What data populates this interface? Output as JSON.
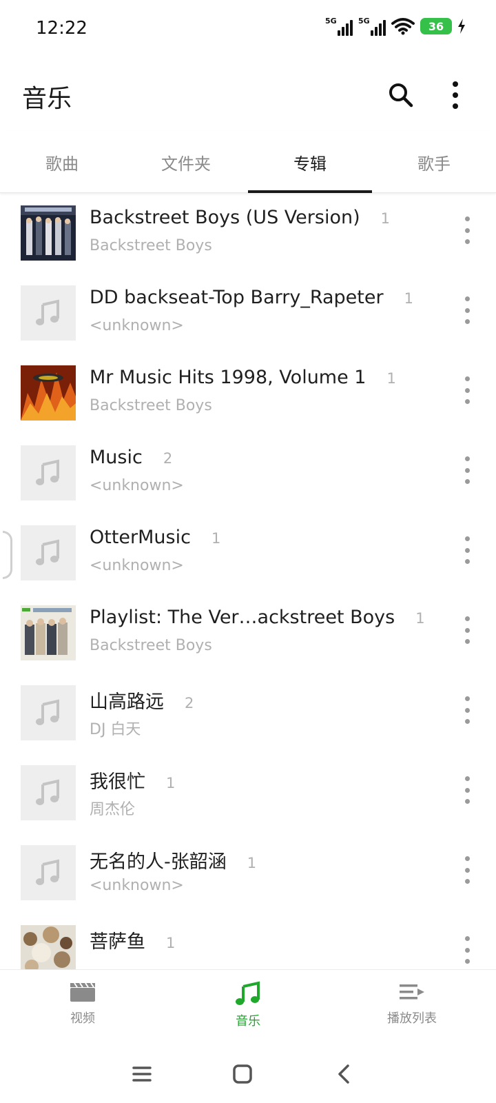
{
  "status_bar": {
    "time": "12:22",
    "signal_label": "5G",
    "battery": "36"
  },
  "app_bar": {
    "title": "音乐",
    "search_icon": "search-icon",
    "more_icon": "more-vert-icon"
  },
  "tabs": [
    {
      "label": "歌曲",
      "active": false
    },
    {
      "label": "文件夹",
      "active": false
    },
    {
      "label": "专辑",
      "active": true
    },
    {
      "label": "歌手",
      "active": false
    }
  ],
  "albums": [
    {
      "title": "Backstreet Boys (US Version)",
      "count": "1",
      "artist": "Backstreet Boys",
      "cover": "album-art-group-photo"
    },
    {
      "title": "DD backseat-Top Barry_Rapeter",
      "count": "1",
      "artist": "<unknown>",
      "cover": "music-note-placeholder"
    },
    {
      "title": "Mr Music Hits 1998, Volume 1",
      "count": "1",
      "artist": "Backstreet Boys",
      "cover": "album-art-orange"
    },
    {
      "title": "Music",
      "count": "2",
      "artist": "<unknown>",
      "cover": "music-note-placeholder"
    },
    {
      "title": "OtterMusic",
      "count": "1",
      "artist": "<unknown>",
      "cover": "music-note-placeholder"
    },
    {
      "title": "Playlist: The Ver…ackstreet Boys",
      "count": "1",
      "artist": "Backstreet Boys",
      "cover": "album-art-group-photo-green"
    },
    {
      "title": "山高路远",
      "count": "2",
      "artist": "DJ 白天",
      "cover": "music-note-placeholder"
    },
    {
      "title": "我很忙",
      "count": "1",
      "artist": "周杰伦",
      "cover": "music-note-placeholder"
    },
    {
      "title": "无名的人-张韶涵",
      "count": "1",
      "artist": "<unknown>",
      "cover": "music-note-placeholder"
    },
    {
      "title": "菩萨鱼",
      "count": "1",
      "artist": "",
      "cover": "album-art-illustration"
    }
  ],
  "bottom_nav": [
    {
      "label": "视频",
      "icon": "video-clapper-icon",
      "active": false
    },
    {
      "label": "音乐",
      "icon": "music-note-icon",
      "active": true
    },
    {
      "label": "播放列表",
      "icon": "playlist-icon",
      "active": false
    }
  ],
  "system_nav": {
    "menu_icon": "menu-icon",
    "home_icon": "home-icon",
    "back_icon": "back-icon"
  },
  "colors": {
    "accent": "#1fa82c",
    "placeholder_bg": "#eeeeee",
    "secondary_text": "#b0b0b0"
  }
}
